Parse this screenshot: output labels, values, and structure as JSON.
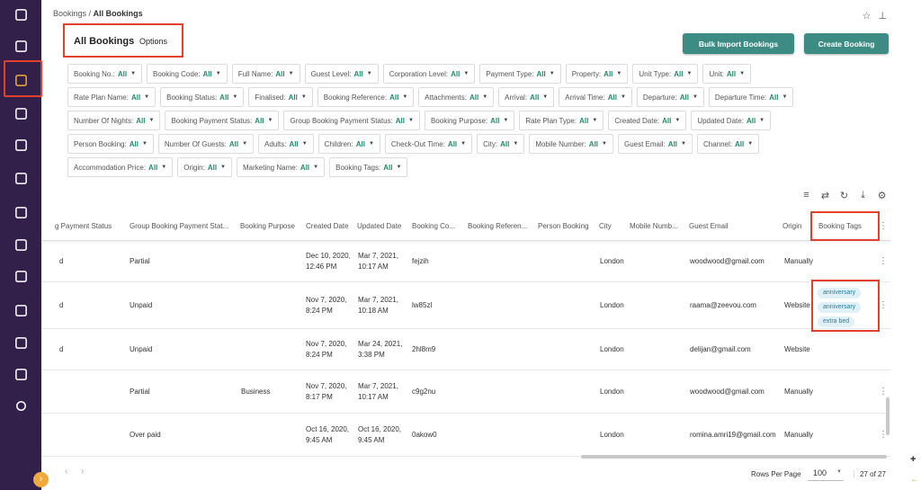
{
  "sidebar": {
    "icons": [
      "chat-icon",
      "calendar-icon",
      "bookings-icon",
      "checklist-icon",
      "tag-icon",
      "home-icon",
      "user-icon",
      "copy-icon",
      "clipboard-icon",
      "analytics-icon",
      "handshake-icon",
      "megaphone-icon",
      "settings-icon"
    ],
    "expand_glyph": "›"
  },
  "breadcrumb": {
    "parent": "Bookings",
    "separator": "/",
    "current": "All Bookings"
  },
  "header": {
    "title": "All Bookings",
    "options": "Options",
    "bulk_import": "Bulk Import Bookings",
    "create": "Create Booking"
  },
  "filters": [
    [
      "Booking No.",
      "Booking Code",
      "Full Name",
      "Guest Level",
      "Corporation Level",
      "Payment Type",
      "Property",
      "Unit Type",
      "Unit"
    ],
    [
      "Rate Plan Name",
      "Booking Status",
      "Finalised",
      "Booking Reference",
      "Attachments",
      "Arrival",
      "Arrival Time",
      "Departure",
      "Departure Time"
    ],
    [
      "Number Of Nights",
      "Booking Payment Status",
      "Group Booking Payment Status",
      "Booking Purpose",
      "Rate Plan Type",
      "Created Date",
      "Updated Date"
    ],
    [
      "Person Booking",
      "Number Of Guests",
      "Adults",
      "Children",
      "Check-Out Time",
      "City",
      "Mobile Number",
      "Guest Email",
      "Channel"
    ],
    [
      "Accommodation Price",
      "Origin",
      "Marketing Name",
      "Booking Tags"
    ]
  ],
  "filter_value": "All",
  "columns": [
    "g Payment Status",
    "Group Booking Payment Stat...",
    "Booking Purpose",
    "Created Date",
    "Updated Date",
    "Booking Co...",
    "Booking Referen...",
    "Person Booking",
    "City",
    "Mobile Numb...",
    "Guest Email",
    "Origin",
    "Booking Tags"
  ],
  "rows": [
    {
      "pay": "d",
      "group": "Partial",
      "purpose": "",
      "c1": "Dec 10, 2020,",
      "c2": "12:46 PM",
      "u1": "Mar 7, 2021,",
      "u2": "10:17 AM",
      "code": "fejzih",
      "city": "London",
      "email": "woodwood@gmail.com",
      "origin": "Manually",
      "tags": []
    },
    {
      "pay": "d",
      "group": "Unpaid",
      "purpose": "",
      "c1": "Nov 7, 2020,",
      "c2": "8:24 PM",
      "u1": "Mar 7, 2021,",
      "u2": "10:18 AM",
      "code": "lw85zl",
      "city": "London",
      "email": "raama@zeevou.com",
      "origin": "Website",
      "tags": [
        "anniversary",
        "anniversary",
        "extra bed"
      ]
    },
    {
      "pay": "d",
      "group": "Unpaid",
      "purpose": "",
      "c1": "Nov 7, 2020,",
      "c2": "8:24 PM",
      "u1": "Mar 24, 2021,",
      "u2": "3:38 PM",
      "code": "2hl8m9",
      "city": "London",
      "email": "delijan@gmail.com",
      "origin": "Website",
      "tags": []
    },
    {
      "pay": "",
      "group": "Partial",
      "purpose": "Business",
      "c1": "Nov 7, 2020,",
      "c2": "8:17 PM",
      "u1": "Mar 7, 2021,",
      "u2": "10:17 AM",
      "code": "c9g2nu",
      "city": "London",
      "email": "woodwood@gmail.com",
      "origin": "Manually",
      "tags": []
    },
    {
      "pay": "",
      "group": "Over paid",
      "purpose": "",
      "c1": "Oct 16, 2020,",
      "c2": "9:45 AM",
      "u1": "Oct 16, 2020,",
      "u2": "9:45 AM",
      "code": "0akow0",
      "city": "London",
      "email": "romina.amri19@gmail.com",
      "origin": "Manually",
      "tags": []
    }
  ],
  "footer": {
    "rows_per_page_label": "Rows Per Page",
    "rows_per_page": "100",
    "range": "27 of 27"
  }
}
